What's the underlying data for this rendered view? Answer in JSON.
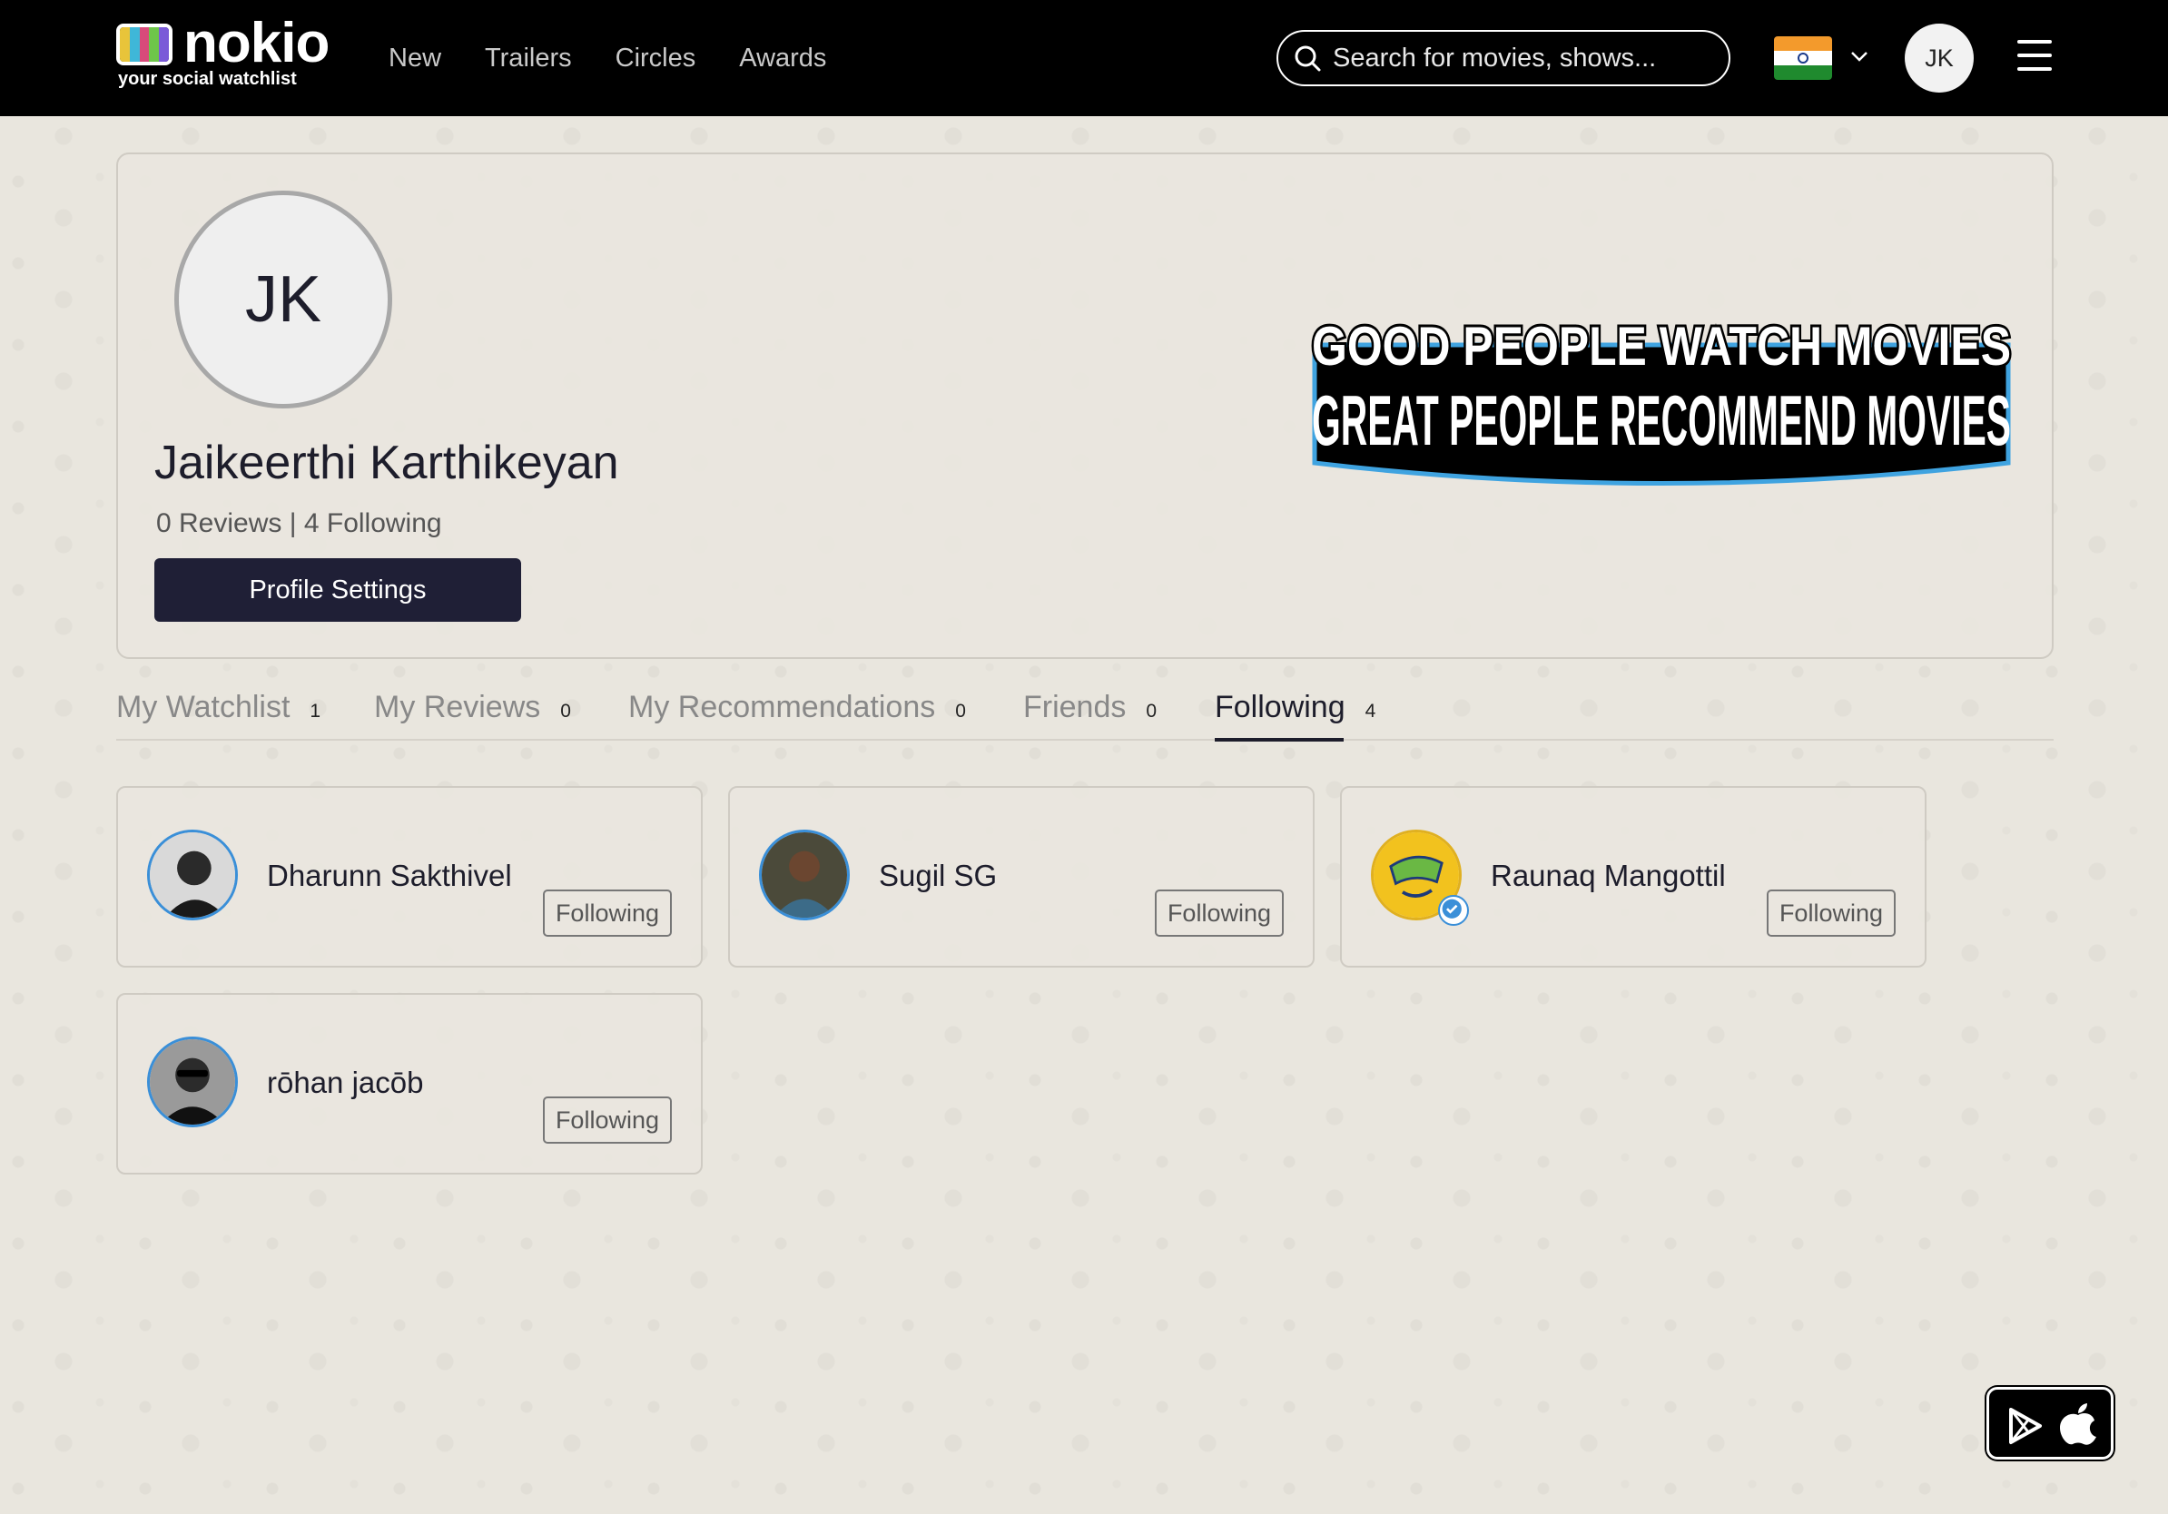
{
  "header": {
    "logo_text": "nokio",
    "tagline": "your social watchlist",
    "nav": [
      "New",
      "Trailers",
      "Circles",
      "Awards"
    ],
    "search_placeholder": "Search for movies, shows...",
    "user_initials": "JK",
    "icons": {
      "search": "search-icon",
      "flag": "india-flag-icon",
      "chevron": "chevron-down-icon",
      "menu": "hamburger-icon"
    }
  },
  "profile": {
    "initials": "JK",
    "name": "Jaikeerthi Karthikeyan",
    "stats": "0 Reviews | 4 Following",
    "settings_label": "Profile Settings",
    "banner_line1": "GOOD PEOPLE WATCH MOVIES",
    "banner_line2": "GREAT PEOPLE RECOMMEND MOVIES"
  },
  "tabs": [
    {
      "label": "My Watchlist",
      "count": "1"
    },
    {
      "label": "My Reviews",
      "count": "0"
    },
    {
      "label": "My Recommendations",
      "count": "0"
    },
    {
      "label": "Friends",
      "count": "0"
    },
    {
      "label": "Following",
      "count": "4",
      "active": true
    }
  ],
  "following": [
    {
      "name": "Dharunn Sakthivel",
      "status": "Following"
    },
    {
      "name": "Sugil SG",
      "status": "Following"
    },
    {
      "name": "Raunaq Mangottil",
      "status": "Following",
      "verified": true
    },
    {
      "name": "rōhan jacōb",
      "status": "Following"
    }
  ],
  "colors": {
    "header_bg": "#000000",
    "accent_dark": "#1f1f36",
    "avatar_ring": "#3a8fd8",
    "page_bg": "#e9e6de"
  }
}
